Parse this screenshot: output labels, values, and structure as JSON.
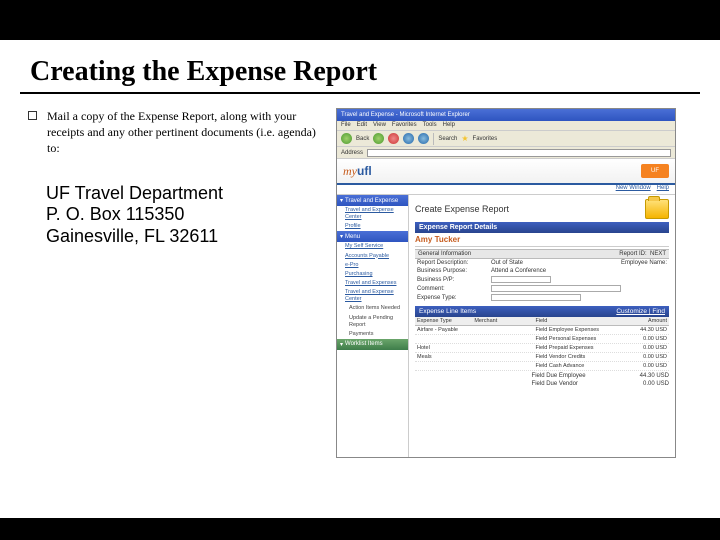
{
  "slide": {
    "title": "Creating the Expense Report",
    "bullet": "Mail a copy of the Expense Report, along with your receipts and any other pertinent documents (i.e. agenda) to:",
    "address": {
      "line1": "UF Travel Department",
      "line2": "P. O. Box 115350",
      "line3": "Gainesville, FL 32611"
    }
  },
  "browser": {
    "titlebar": "Travel and Expense - Microsoft Internet Explorer",
    "menu": [
      "File",
      "Edit",
      "View",
      "Favorites",
      "Tools",
      "Help"
    ],
    "tool_back": "Back",
    "tool_search": "Search",
    "tool_fav": "Favorites",
    "addr_label": "Address"
  },
  "portal": {
    "logo_my": "my",
    "logo_ufl": "ufl",
    "uf_badge": "UF",
    "links": [
      "New Window",
      "Help"
    ]
  },
  "sidebar": {
    "s1": {
      "title": "Travel and Expense",
      "items": [
        "Travel and Expense Center",
        "Profile"
      ]
    },
    "s2": {
      "title": "Menu",
      "items": [
        "My Self Service",
        "Accounts Payable",
        "e-Pro",
        "Purchasing",
        "Travel and Expenses",
        "Travel and Expense Center"
      ],
      "subitems": [
        "Action Items Needed",
        "Update a Pending Report",
        "Payments"
      ]
    },
    "s3": {
      "title": "Worklist Items"
    }
  },
  "main": {
    "page_title": "Create Expense Report",
    "bar1": "Expense Report Details",
    "tab": "Amy Tucker",
    "gen_hdr_left": "General Information",
    "gen_hdr_right_lbl": "Report ID:",
    "gen_hdr_right_val": "NEXT",
    "form": {
      "desc_lbl": "Report Description:",
      "desc_val": "Out of State",
      "emp_lbl": "Employee Name:",
      "biz_lbl": "Business Purpose:",
      "biz_val": "Attend a Conference",
      "bizpp_lbl": "Business P/P:",
      "comment_lbl": "Comment:",
      "exp_lbl": "Expense Type:"
    },
    "bar2_left": "Expense Line Items",
    "bar2_right": "Customize | Find",
    "thead": [
      "Expense Type",
      "Merchant",
      "Field",
      "Amount"
    ],
    "rows": [
      {
        "type": "Airfare - Payable",
        "merchant": "",
        "field": "Field Employee Expenses",
        "amt": "44.30 USD"
      },
      {
        "type": "",
        "merchant": "",
        "field": "Field Personal Expenses",
        "amt": "0.00 USD"
      },
      {
        "type": "Hotel",
        "merchant": "",
        "field": "Field Prepaid Expenses",
        "amt": "0.00 USD"
      },
      {
        "type": "Meals",
        "merchant": "",
        "field": "Field Vendor Credits",
        "amt": "0.00 USD"
      },
      {
        "type": "",
        "merchant": "",
        "field": "Field Cash Advance",
        "amt": "0.00 USD"
      }
    ],
    "totals": [
      {
        "lbl": "Field Due Employee",
        "val": "44.30 USD"
      },
      {
        "lbl": "Field Due Vendor",
        "val": "0.00 USD"
      }
    ]
  }
}
